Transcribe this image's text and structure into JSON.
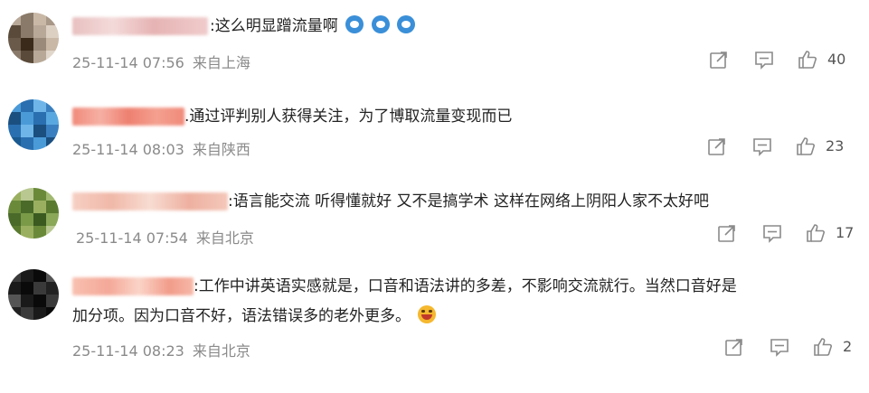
{
  "comments": [
    {
      "text": ":这么明显蹭流量啊",
      "emojis": [
        "doge-emoji",
        "doge-emoji",
        "doge-emoji"
      ],
      "timestamp": "25-11-14 07:56",
      "location": "来自上海",
      "likes": "40",
      "name_blur_color": "#e6b3b3",
      "avatar_colors": [
        "#8a7a6a",
        "#b8a898",
        "#5a4a3a",
        "#c9b8a6"
      ]
    },
    {
      "text": ".通过评判别人获得关注，为了博取流量变现而已",
      "timestamp": "25-11-14 08:03",
      "location": "来自陕西",
      "likes": "23",
      "name_blur_color": "#f08a7a",
      "avatar_colors": [
        "#2a6fb0",
        "#4a9ad8",
        "#1a4f80",
        "#6fb5e8"
      ]
    },
    {
      "text": ":语言能交流 听得懂就好 又不是搞学术 这样在网络上阴阳人家不太好吧",
      "timestamp": "25-11-14 07:54",
      "location": "来自北京",
      "likes": "17",
      "name_blur_color": "#f0b8a8",
      "avatar_colors": [
        "#6a8a3a",
        "#9ab060",
        "#4a6a2a",
        "#b8c890"
      ]
    },
    {
      "text_line1": ":工作中讲英语实感就是，口音和语法讲的多差，不影响交流就行。当然口音好是",
      "text_line2": "加分项。因为口音不好，语法错误多的老外更多。",
      "emojis": [
        "laughing-emoji"
      ],
      "timestamp": "25-11-14 08:23",
      "location": "来自北京",
      "likes": "2",
      "name_blur_color": "#f4a898",
      "avatar_colors": [
        "#1a1a1a",
        "#3a3a3a",
        "#0a0a0a",
        "#555555"
      ]
    }
  ],
  "colors": {
    "icon": "#8a8a8a",
    "meta_text": "#8a8a8a",
    "emoji_blue": "#3a8fd8",
    "emoji_yellow": "#f5b82e"
  },
  "icons": [
    "share-icon",
    "comment-icon",
    "like-icon"
  ]
}
